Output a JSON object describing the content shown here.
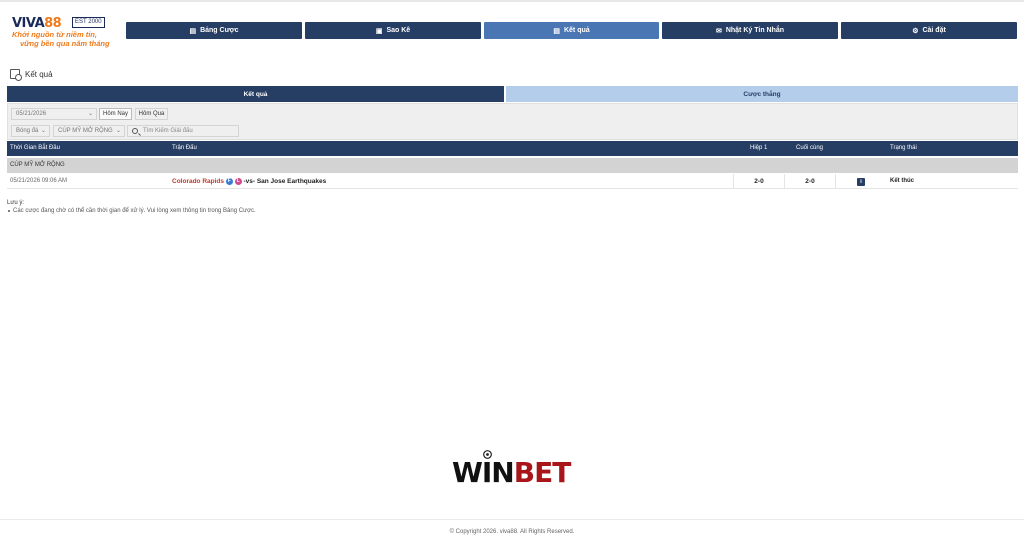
{
  "brand": {
    "logo_text_a": "VIVA",
    "logo_text_b": "88",
    "est": "EST 2000",
    "slogan_line1": "Khởi nguồn từ niềm tin,",
    "slogan_line2": "vững bền qua năm tháng"
  },
  "nav": {
    "items": [
      {
        "label": "Bảng Cược",
        "icon": "table-icon"
      },
      {
        "label": "Sao Kê",
        "icon": "statement-icon"
      },
      {
        "label": "Kết quả",
        "icon": "results-icon",
        "active": true
      },
      {
        "label": "Nhật Ký Tin Nhắn",
        "icon": "envelope-icon"
      },
      {
        "label": "Cài đặt",
        "icon": "gear-icon"
      }
    ]
  },
  "page": {
    "title": "Kết quả"
  },
  "tabs": [
    {
      "label": "Kết quả",
      "active": true
    },
    {
      "label": "Cược thắng",
      "active": false
    }
  ],
  "filters": {
    "date_value": "05/21/2026",
    "today_label": "Hôm Nay",
    "yesterday_label": "Hôm Qua",
    "sport_value": "Bóng đá",
    "league_value": "CÚP MỸ MỞ RỘNG",
    "search_placeholder": "Tìm Kiếm Giải đấu"
  },
  "table": {
    "headers": {
      "start_time": "Thời Gian Bắt Đầu",
      "match": "Trận Đấu",
      "half1": "Hiệp 1",
      "final": "Cuối cùng",
      "status": "Trạng thái"
    },
    "league": "CÚP MỸ MỞ RỘNG",
    "rows": [
      {
        "time": "05/21/2026 09:06 AM",
        "home": "Colorado Rapids",
        "badge1": "F",
        "badge2": "L",
        "vs": "-vs-",
        "away": "San Jose Earthquakes",
        "half1": "2-0",
        "final": "2-0",
        "info": "i",
        "status": "Kết thúc"
      }
    ]
  },
  "notes": {
    "title": "Lưu ý:",
    "items": [
      "Các cược đang chờ có thể cần thời gian để xử lý. Vui lòng xem thông tin trong Bảng Cược."
    ]
  },
  "sponsor": {
    "word_a": "WIN",
    "word_b": "BET"
  },
  "footer": {
    "copyright": "© Copyright 2026. viva88. All Rights Reserved."
  },
  "colors": {
    "navy": "#263d64",
    "active_blue": "#4a77b4",
    "light_blue_tab": "#b4cdeb",
    "brand_orange": "#f07a1a",
    "team_red": "#c0392b",
    "bet_red": "#a8161b"
  }
}
